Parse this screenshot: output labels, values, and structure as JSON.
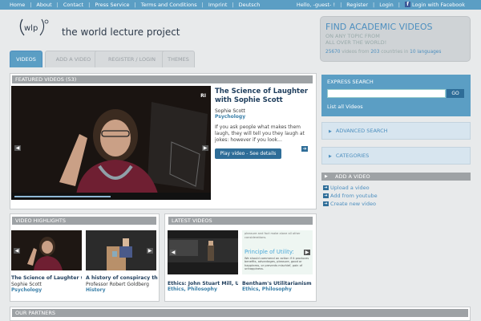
{
  "topbar": {
    "left_links": [
      "Home",
      "About",
      "Contact",
      "Press Service",
      "Terms and Conditions",
      "Imprint",
      "Deutsch"
    ],
    "greeting": "Hello, -guest- !",
    "register": "Register",
    "login": "Login",
    "facebook": "Login with Facebook"
  },
  "header": {
    "logo_text": "wlp",
    "site_name": "the world lecture project"
  },
  "findbox": {
    "title": "FIND ACADEMIC VIDEOS",
    "line1": "ON ANY TOPIC FROM",
    "line2": "ALL OVER THE WORLD!",
    "count_videos": "25670",
    "mid": "videos from",
    "count_countries": "203",
    "mid2": "countries in",
    "count_languages": "10 languages"
  },
  "tabs": [
    "VIDEOS",
    "ADD A VIDEO",
    "REGISTER / LOGIN",
    "THEMES"
  ],
  "featured": {
    "heading": "FEATURED VIDEOS (53)",
    "title": "The Science of Laughter with Sophie Scott",
    "speaker": "Sophie Scott",
    "category": "Psychology",
    "description": "If you ask people what makes them laugh, they will tell you they laugh at jokes: however if you look...",
    "play_label": "Play video - See details",
    "player_badge": "RI"
  },
  "sidebar": {
    "express_heading": "EXPRESS SEARCH",
    "search_placeholder": "",
    "go_label": "GO",
    "list_all": "List all Videos",
    "advanced": "ADVANCED SEARCH",
    "categories": "CATEGORIES",
    "add_heading": "ADD A VIDEO",
    "upload": "Upload a video",
    "youtube": "Add from youtube",
    "create": "Create new video"
  },
  "highlights": {
    "heading": "VIDEO HIGHLIGHTS",
    "items": [
      {
        "title": "The Science of Laughter w...",
        "speaker": "Sophie Scott",
        "category": "Psychology"
      },
      {
        "title": "A history of conspiracy th...",
        "speaker": "Professor Robert Goldberg",
        "category": "History"
      }
    ]
  },
  "latest": {
    "heading": "LATEST VIDEOS",
    "items": [
      {
        "title": "Ethics: John Stuart Mill, U...",
        "category": "Ethics, Philosophy"
      },
      {
        "title": "Bentham's Utilitarianism",
        "category": "Ethics, Philosophy",
        "slide_title": "Principle of Utility:",
        "slide_text_top": "pleasure and fact make alone all other considerations.",
        "slide_text": "We should commend an action if it produces benefits, advantages, pleasure, good or happiness, or prevents mischief, pain of unhappiness."
      }
    ]
  },
  "partners": {
    "heading": "OUR PARTNERS"
  },
  "colors": {
    "accent": "#5b9ec4",
    "dark_button": "#2e6d98",
    "panel_head": "#9ea2a5"
  }
}
